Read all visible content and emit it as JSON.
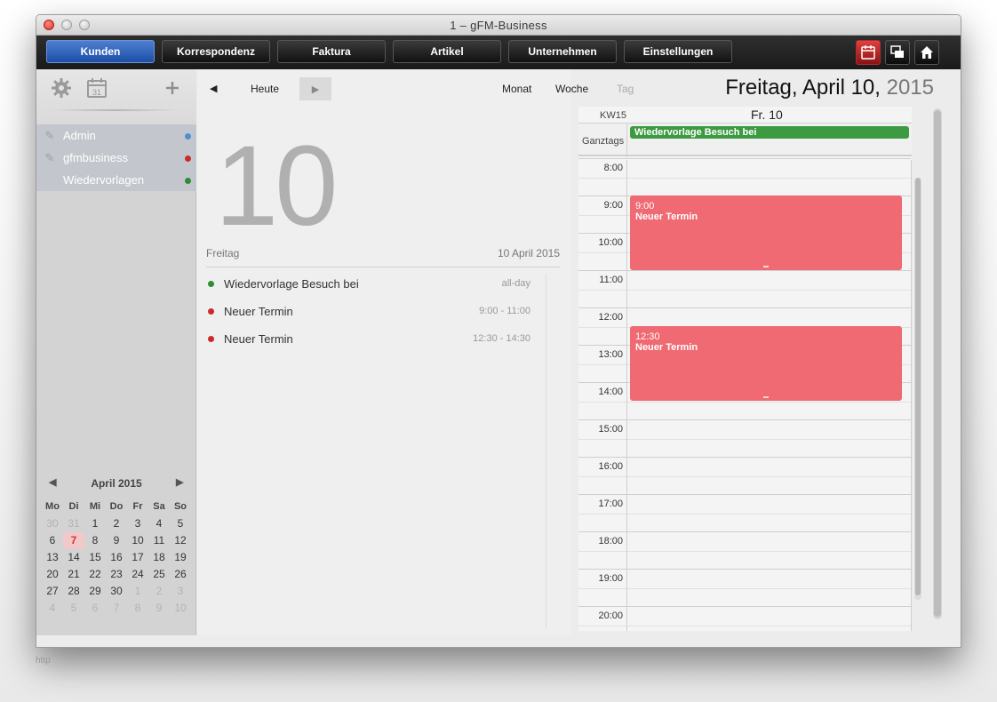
{
  "window": {
    "title": "1 – gFM-Business"
  },
  "nav": {
    "buttons": [
      "Kunden",
      "Korrespondenz",
      "Faktura",
      "Artikel",
      "Unternehmen",
      "Einstellungen"
    ],
    "active": "Kunden"
  },
  "sidebar": {
    "items": [
      {
        "label": "Admin",
        "dot": "#4a8fd0"
      },
      {
        "label": "gfmbusiness",
        "dot": "#cc2a2a"
      },
      {
        "label": "Wiedervorlagen",
        "dot": "#2e8b36"
      }
    ]
  },
  "mini_calendar": {
    "title": "April 2015",
    "weekdays": [
      "Mo",
      "Di",
      "Mi",
      "Do",
      "Fr",
      "Sa",
      "So"
    ],
    "weeks": [
      [
        "30",
        "31",
        "1",
        "2",
        "3",
        "4",
        "5"
      ],
      [
        "6",
        "7",
        "8",
        "9",
        "10",
        "11",
        "12"
      ],
      [
        "13",
        "14",
        "15",
        "16",
        "17",
        "18",
        "19"
      ],
      [
        "20",
        "21",
        "22",
        "23",
        "24",
        "25",
        "26"
      ],
      [
        "27",
        "28",
        "29",
        "30",
        "1",
        "2",
        "3"
      ],
      [
        "4",
        "5",
        "6",
        "7",
        "8",
        "9",
        "10"
      ]
    ]
  },
  "middle": {
    "today_label": "Heute",
    "views": {
      "month": "Monat",
      "week": "Woche",
      "day": "Tag"
    },
    "big_day": "10",
    "weekday": "Freitag",
    "date_text": "10 April 2015",
    "events": [
      {
        "name": "Wiedervorlage Besuch bei",
        "time": "all-day",
        "color": "#2e8b36"
      },
      {
        "name": "Neuer Termin",
        "time": "9:00 - 11:00",
        "color": "#cc2a2a"
      },
      {
        "name": "Neuer Termin",
        "time": "12:30 - 14:30",
        "color": "#cc2a2a"
      }
    ]
  },
  "header": {
    "date_main": "Freitag, April 10,",
    "year": "2015"
  },
  "daycal": {
    "kw": "KW15",
    "column": "Fr. 10",
    "allday_label": "Ganztags",
    "allday_event": "Wiedervorlage Besuch bei",
    "hours": [
      "8:00",
      "9:00",
      "10:00",
      "11:00",
      "12:00",
      "13:00",
      "14:00",
      "15:00",
      "16:00",
      "17:00",
      "18:00",
      "19:00",
      "20:00"
    ],
    "events": [
      {
        "time": "9:00",
        "name": "Neuer Termin"
      },
      {
        "time": "12:30",
        "name": "Neuer Termin"
      }
    ]
  },
  "status": {
    "text": "http"
  }
}
